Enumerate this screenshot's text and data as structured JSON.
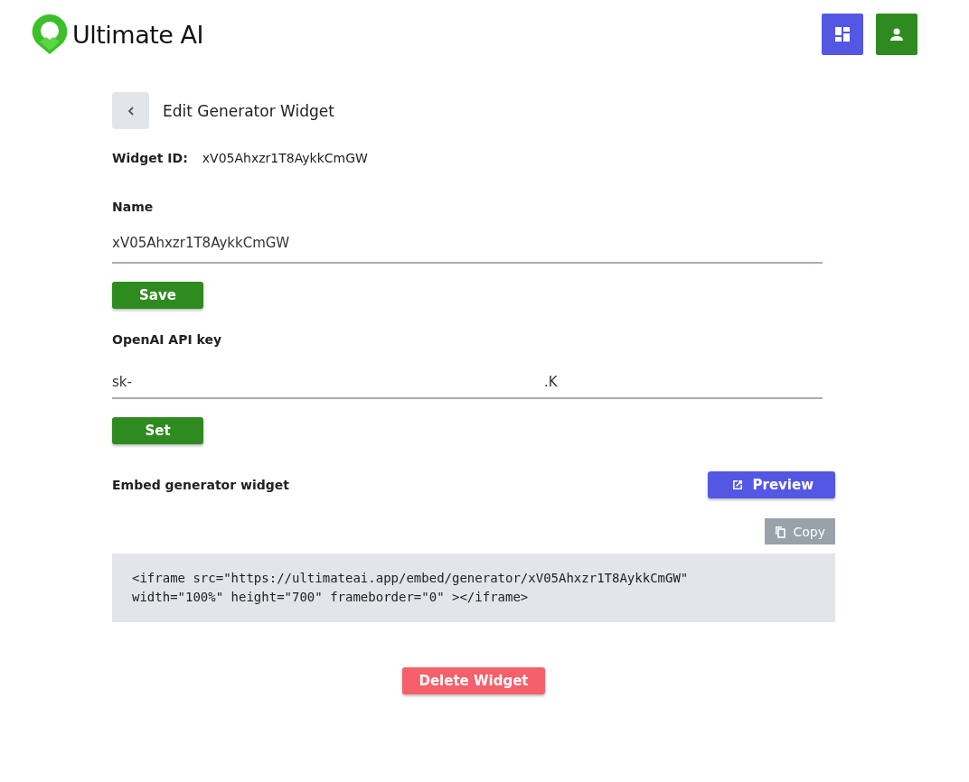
{
  "header": {
    "brand": "Ultimate AI",
    "actions": [
      {
        "kind": "dashboard",
        "color": "#5457e3"
      },
      {
        "kind": "account",
        "color": "#2e8b1f"
      }
    ]
  },
  "page": {
    "title": "Edit Generator Widget"
  },
  "widget_id": {
    "label": "Widget ID:",
    "value": "xV05Ahxzr1T8AykkCmGW"
  },
  "name_field": {
    "label": "Name",
    "value": "xV05Ahxzr1T8AykkCmGW",
    "button": "Save"
  },
  "api_key_field": {
    "label": "OpenAI API key",
    "value": "sk-",
    "tail": ".K",
    "button": "Set"
  },
  "embed": {
    "label": "Embed generator widget",
    "preview": "Preview",
    "copy": "Copy",
    "code": "<iframe src=\"https://ultimateai.app/embed/generator/xV05Ahxzr1T8AykkCmGW\"\nwidth=\"100%\" height=\"700\" frameborder=\"0\" ></iframe>"
  },
  "delete_button": "Delete Widget"
}
